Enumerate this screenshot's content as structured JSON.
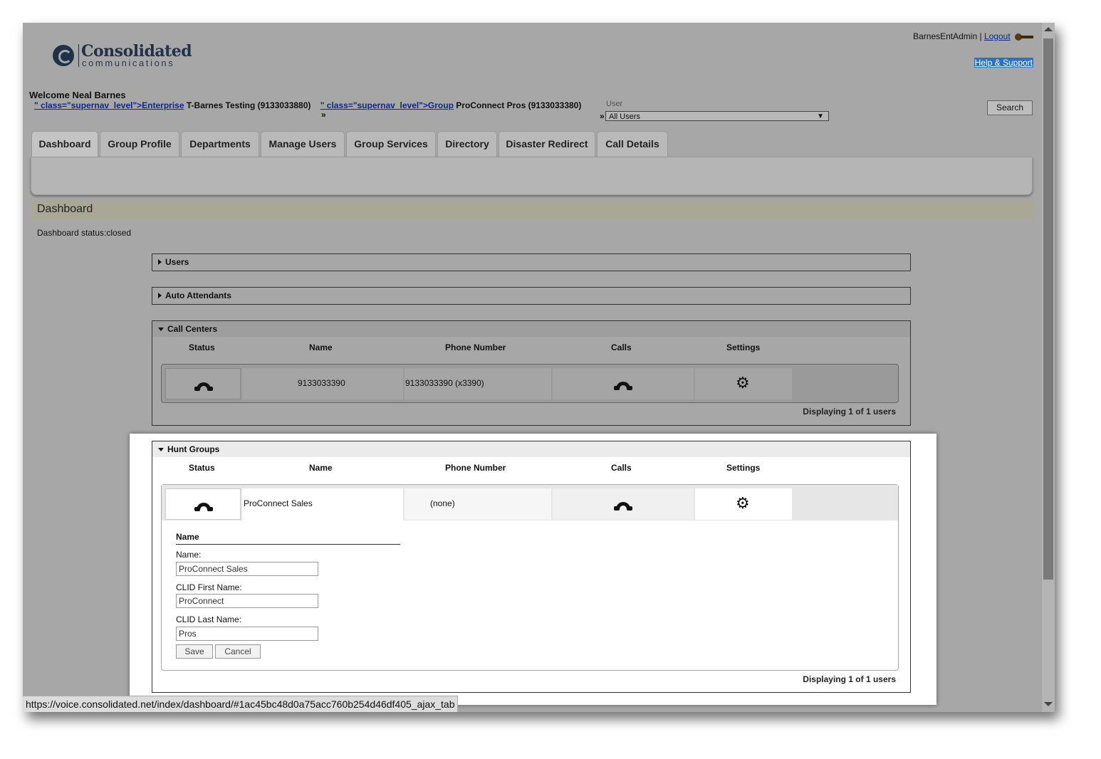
{
  "header": {
    "logo_main": "Consolidated",
    "logo_sub": "communications",
    "username": "BarnesEntAdmin",
    "separator": "|",
    "logout": "Logout",
    "help": "Help & Support"
  },
  "welcome": "Welcome Neal Barnes",
  "nav": {
    "enterprise_link": "\" class=\"supernav_level\">Enterprise",
    "enterprise_text": "T-Barnes Testing (9133033880)",
    "raquo": "»",
    "group_link": "\" class=\"supernav_level\">Group",
    "group_text": "ProConnect Pros (9133033380)",
    "user_label": "User",
    "user_select": "All Users",
    "search": "Search"
  },
  "tabs": [
    "Dashboard",
    "Group Profile",
    "Departments",
    "Manage Users",
    "Group Services",
    "Directory",
    "Disaster Redirect",
    "Call Details"
  ],
  "dashboard": {
    "title": "Dashboard",
    "status": "Dashboard status:closed"
  },
  "sections": {
    "users": "Users",
    "auto_attendants": "Auto Attendants"
  },
  "columns": [
    "Status",
    "Name",
    "Phone Number",
    "Calls",
    "Settings"
  ],
  "call_centers": {
    "title": "Call Centers",
    "row": {
      "name": "9133033390",
      "phone": "9133033390 (x3390)"
    },
    "footer": "Displaying 1 of 1 users"
  },
  "hunt_groups": {
    "title": "Hunt Groups",
    "row": {
      "name": "ProConnect Sales",
      "phone": "(none)"
    },
    "form": {
      "heading": "Name",
      "name_label": "Name:",
      "name_value": "ProConnect Sales",
      "clid_first_label": "CLID First Name:",
      "clid_first_value": "ProConnect",
      "clid_last_label": "CLID Last Name:",
      "clid_last_value": "Pros",
      "save": "Save",
      "cancel": "Cancel"
    },
    "footer": "Displaying 1 of 1 users"
  },
  "statusbar_url": "https://voice.consolidated.net/index/dashboard/#1ac45bc48d0a75acc760b254d46df405_ajax_tab",
  "icons": [
    "phone-icon",
    "gear-icon",
    "key-icon",
    "chevron-right-icon",
    "chevron-down-icon"
  ],
  "colors": {
    "page_bg": "#a7a7a7",
    "highlight_bg": "#ffffff",
    "link": "#0a2a8a",
    "help_bg": "#2f6fc0",
    "dashbar": "#a9a795"
  }
}
